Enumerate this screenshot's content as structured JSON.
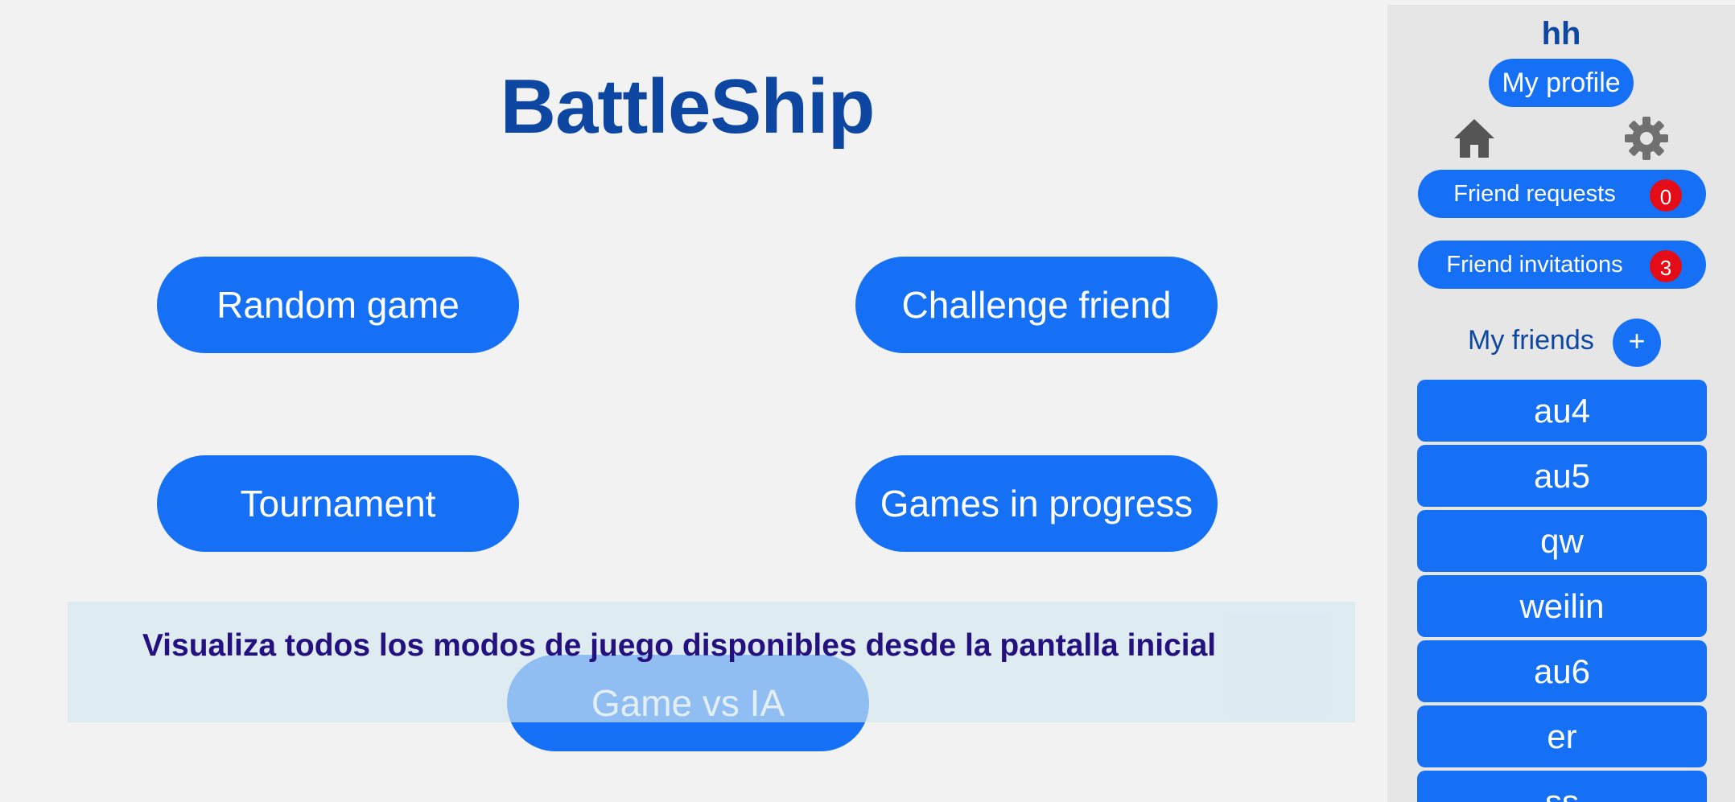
{
  "app": {
    "title": "BattleShip"
  },
  "modes": {
    "random_game": "Random game",
    "challenge_friend": "Challenge friend",
    "tournament": "Tournament",
    "games_in_progress": "Games in progress",
    "game_vs_ia": "Game vs IA"
  },
  "tutorial": {
    "text": "Visualiza todos los modos de juego disponibles desde la pantalla inicial"
  },
  "sidebar": {
    "username": "hh",
    "profile_label": "My profile",
    "icons": [
      "home-icon",
      "gear-icon"
    ],
    "friend_requests": {
      "label": "Friend requests",
      "count": "0"
    },
    "friend_invitations": {
      "label": "Friend invitations",
      "count": "3"
    },
    "friends_label": "My friends",
    "add_friend_label": "+",
    "friends": [
      "au4",
      "au5",
      "qw",
      "weilin",
      "au6",
      "er",
      "ss"
    ]
  },
  "colors": {
    "accent": "#1570f6",
    "title": "#0d47a1",
    "badge": "#e40c16",
    "tutorial_text": "#24107f",
    "background": "#f2f2f2",
    "sidebar": "#e6e6e6"
  }
}
